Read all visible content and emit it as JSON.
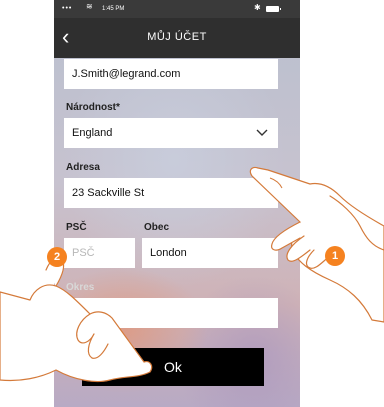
{
  "status_bar": {
    "signal": "•••",
    "time": "1:45 PM",
    "wifi_icon": "wifi-icon",
    "bluetooth_icon": "bluetooth-icon",
    "battery_icon": "battery-icon"
  },
  "header": {
    "back_symbol": "‹",
    "title": "MŮJ ÚČET"
  },
  "form": {
    "email": {
      "value": "J.Smith@legrand.com"
    },
    "nationality": {
      "label": "Národnost*",
      "value": "England"
    },
    "address": {
      "label": "Adresa",
      "value": "23 Sackville St"
    },
    "postcode": {
      "label": "PSČ",
      "placeholder": "PSČ"
    },
    "city": {
      "label": "Obec",
      "value": "London"
    },
    "district": {
      "label": "Okres",
      "value": ""
    }
  },
  "ok_button": {
    "label": "Ok"
  },
  "callouts": [
    {
      "number": "1"
    },
    {
      "number": "2"
    }
  ],
  "colors": {
    "accent": "#f58220",
    "header_bg": "#2f2f2f",
    "button_bg": "#000000"
  }
}
